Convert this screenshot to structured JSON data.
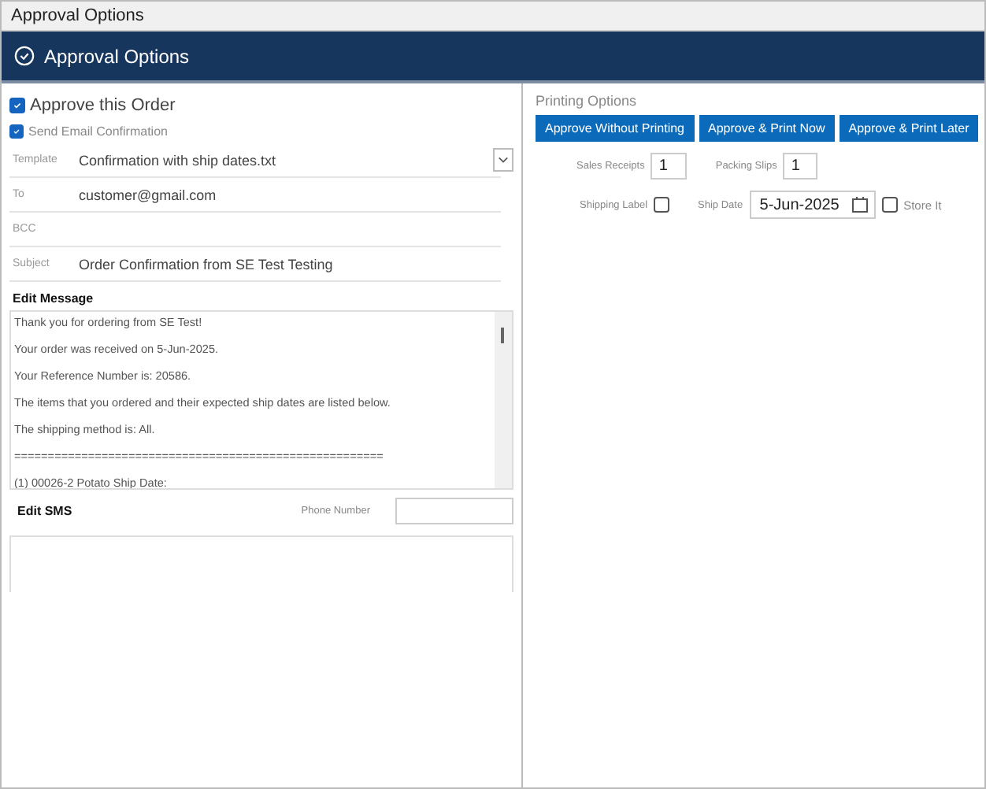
{
  "window": {
    "title": "Approval Options"
  },
  "header": {
    "title": "Approval Options"
  },
  "approve_order": {
    "label": "Approve this Order",
    "checked": true
  },
  "send_email": {
    "label": "Send Email Confirmation",
    "checked": true
  },
  "fields": [
    {
      "label": "Template",
      "value": "Confirmation with ship dates.txt",
      "kind": "dropdown"
    },
    {
      "label": "To",
      "value": "customer@gmail.com",
      "kind": "text"
    },
    {
      "label": "BCC",
      "kind": "text"
    },
    {
      "label": "Subject",
      "value": "Order Confirmation from SE Test Testing",
      "kind": "text"
    }
  ],
  "edit_message": {
    "heading": "Edit Message",
    "lines": [
      "Thank you for ordering from SE Test!",
      "Your order was received on 5-Jun-2025.",
      "Your Reference Number is: 20586.",
      "The items that you ordered and their expected ship dates are listed below.",
      "The shipping method is: All.",
      "=======================================================",
      "(1)     00026-2     Potato   Ship Date:"
    ]
  },
  "edit_sms": {
    "heading": "Edit SMS",
    "phone_label": "Phone Number"
  },
  "printing_options": {
    "heading": "Printing Options",
    "buttons": [
      "Approve Without Printing",
      "Approve & Print Now",
      "Approve & Print Later"
    ],
    "sales_receipts": {
      "label": "Sales Receipts",
      "value": "1"
    },
    "packing_slips": {
      "label": "Packing Slips",
      "value": "1"
    },
    "shipping_label": {
      "label": "Shipping Label",
      "checked": false
    },
    "ship_date": {
      "label": "Ship Date",
      "value": "5-Jun-2025"
    },
    "store_it": {
      "label": "Store It",
      "checked": false
    }
  }
}
